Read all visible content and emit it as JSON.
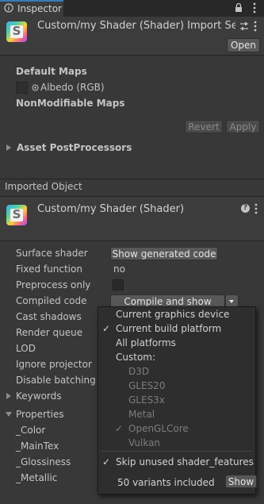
{
  "tab": {
    "label": "Inspector"
  },
  "header": {
    "title": "Custom/my Shader (Shader) Import Settings",
    "open_button": "Open"
  },
  "import_settings": {
    "default_maps_label": "Default Maps",
    "albedo_label": "Albedo (RGB)",
    "nonmodifiable_label": "NonModifiable Maps",
    "revert_button": "Revert",
    "apply_button": "Apply",
    "asset_postprocessors_label": "Asset PostProcessors"
  },
  "imported_object": {
    "section_label": "Imported Object",
    "title": "Custom/my Shader (Shader)",
    "help_icon": "?"
  },
  "fields": {
    "surface_shader_label": "Surface shader",
    "surface_shader_button": "Show generated code",
    "fixed_function_label": "Fixed function",
    "fixed_function_value": "no",
    "preprocess_only_label": "Preprocess only",
    "compiled_code_label": "Compiled code",
    "compiled_code_button": "Compile and show code",
    "cast_shadows_label": "Cast shadows",
    "render_queue_label": "Render queue",
    "lod_label": "LOD",
    "ignore_projector_label": "Ignore projector",
    "disable_batching_label": "Disable batching",
    "keywords_label": "Keywords",
    "properties_label": "Properties",
    "properties": [
      "_Color",
      "_MainTex",
      "_Glossiness",
      "_Metallic"
    ]
  },
  "menu": {
    "items": {
      "current_graphics_device": "Current graphics device",
      "current_build_platform": "Current build platform",
      "all_platforms": "All platforms",
      "custom": "Custom:",
      "d3d": "D3D",
      "gles20": "GLES20",
      "gles3x": "GLES3x",
      "metal": "Metal",
      "openglcore": "OpenGLCore",
      "vulkan": "Vulkan",
      "skip_unused": "Skip unused shader_features",
      "variants_included": "50 variants included",
      "show_button": "Show"
    },
    "check_mark": "✓"
  },
  "colors": {
    "background": "#383838",
    "tab_accent": "#3a79bb",
    "menu_background": "#2e2e2e"
  }
}
